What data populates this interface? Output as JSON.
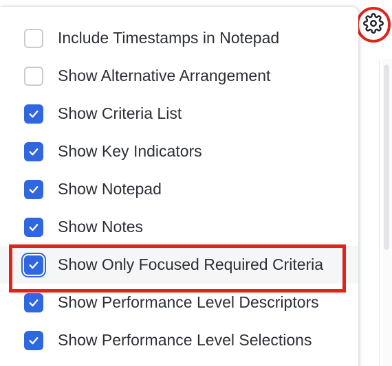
{
  "settings": {
    "icon": "gear-icon",
    "highlight_color": "#e12319"
  },
  "menu": {
    "accent_color": "#2f67e0",
    "items": [
      {
        "label": "Include Timestamps in Notepad",
        "checked": false
      },
      {
        "label": "Show Alternative Arrangement",
        "checked": false
      },
      {
        "label": "Show Criteria List",
        "checked": true
      },
      {
        "label": "Show Key Indicators",
        "checked": true
      },
      {
        "label": "Show Notepad",
        "checked": true
      },
      {
        "label": "Show Notes",
        "checked": true
      },
      {
        "label": "Show Only Focused Required Criteria",
        "checked": true,
        "focused": true,
        "highlighted": true
      },
      {
        "label": "Show Performance Level Descriptors",
        "checked": true
      },
      {
        "label": "Show Performance Level Selections",
        "checked": true
      }
    ]
  }
}
